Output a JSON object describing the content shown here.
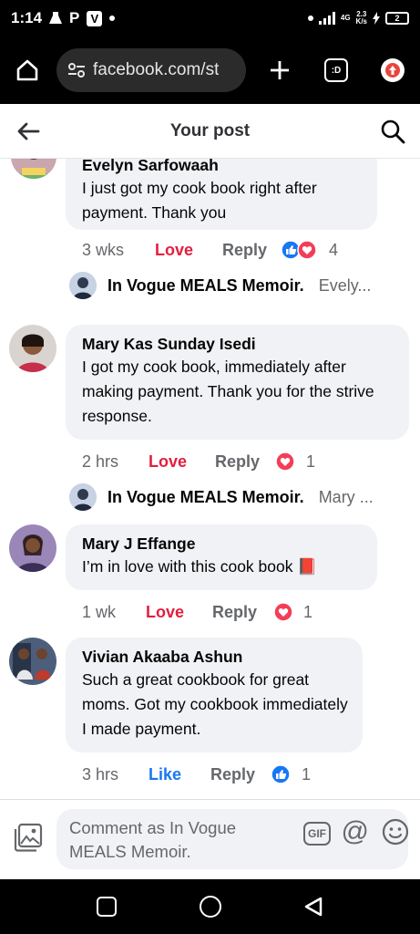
{
  "status_bar": {
    "time": "1:14",
    "app_letter_p": "P",
    "app_letter_v": "V",
    "network_type": "4G",
    "network_speed_value": "2.3",
    "network_speed_unit": "K/s",
    "battery": "2"
  },
  "browser": {
    "url": "facebook.com/st",
    "tabs_count_label": ":D"
  },
  "header": {
    "title": "Your post"
  },
  "comments": [
    {
      "author": "Evelyn Sarfowaah",
      "text": "I just got my cook book right after payment. Thank you",
      "time": "3 wks",
      "reaction_label": "Love",
      "reply_label": "Reply",
      "reaction_count": "4",
      "reply_preview_author": "In Vogue MEALS Memoir.",
      "reply_preview_text": "Evely..."
    },
    {
      "author": "Mary Kas Sunday Isedi",
      "text": "I got my cook book, immediately after making payment. Thank you for the strive response.",
      "time": "2 hrs",
      "reaction_label": "Love",
      "reply_label": "Reply",
      "reaction_count": "1",
      "reply_preview_author": "In Vogue MEALS Memoir.",
      "reply_preview_text": "Mary ..."
    },
    {
      "author": "Mary J Effange",
      "text": "I’m in love with this cook book 📕",
      "time": "1 wk",
      "reaction_label": "Love",
      "reply_label": "Reply",
      "reaction_count": "1"
    },
    {
      "author": "Vivian Akaaba Ashun",
      "text": "Such a great cookbook for great moms. Got my cookbook immediately I made payment.",
      "time": "3 hrs",
      "reaction_label": "Like",
      "reply_label": "Reply",
      "reaction_count": "1"
    }
  ],
  "composer": {
    "placeholder": "Comment as In Vogue MEALS Memoir.",
    "gif_label": "GIF"
  },
  "colors": {
    "love": "#e41e3f",
    "like": "#1877f2",
    "bubble": "#f0f2f5",
    "muted": "#65676b"
  }
}
